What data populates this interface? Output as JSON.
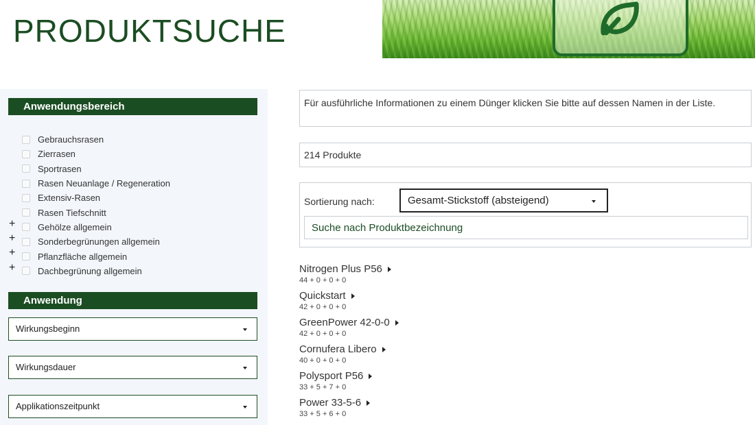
{
  "page": {
    "title": "PRODUKTSUCHE"
  },
  "sidebar": {
    "anwendungsbereich_title": "Anwendungsbereich",
    "anwendungsbereich_items": [
      {
        "label": "Gebrauchsrasen",
        "expandable": false
      },
      {
        "label": "Zierrasen",
        "expandable": false
      },
      {
        "label": "Sportrasen",
        "expandable": false
      },
      {
        "label": "Rasen Neuanlage / Regeneration",
        "expandable": false
      },
      {
        "label": "Extensiv-Rasen",
        "expandable": false
      },
      {
        "label": "Rasen Tiefschnitt",
        "expandable": false
      },
      {
        "label": "Gehölze allgemein",
        "expandable": true
      },
      {
        "label": "Sonderbegrünungen allgemein",
        "expandable": true
      },
      {
        "label": "Pflanzfläche allgemein",
        "expandable": true
      },
      {
        "label": "Dachbegrünung allgemein",
        "expandable": true
      }
    ],
    "expand_symbol": "+",
    "anwendung_title": "Anwendung",
    "selects": {
      "wirkungsbeginn": "Wirkungsbeginn",
      "wirkungsdauer": "Wirkungsdauer",
      "applikationszeitpunkt": "Applikationszeitpunkt"
    }
  },
  "main": {
    "info_text": "Für ausführliche Informationen zu einem Dünger klicken Sie bitte auf dessen Namen in der Liste.",
    "count_text": "214 Produkte",
    "sort_label": "Sortierung nach:",
    "sort_value": "Gesamt-Stickstoff (absteigend)",
    "search_placeholder": "Suche nach Produktbezeichnung",
    "products": [
      {
        "name": "Nitrogen Plus P56",
        "npk": "44 + 0 + 0 + 0"
      },
      {
        "name": "Quickstart",
        "npk": "42 + 0 + 0 + 0"
      },
      {
        "name": "GreenPower 42-0-0",
        "npk": "42 + 0 + 0 + 0"
      },
      {
        "name": "Cornufera Libero",
        "npk": "40 + 0 + 0 + 0"
      },
      {
        "name": "Polysport P56",
        "npk": "33 + 5 + 7 + 0"
      },
      {
        "name": "Power 33-5-6",
        "npk": "33 + 5 + 6 + 0"
      }
    ]
  },
  "colors": {
    "brand_green": "#1b4d22",
    "border_gray": "#c9ced3",
    "sidebar_bg": "#f3f6fb"
  },
  "icons": {
    "banner": "leaf-icon",
    "dropdown": "caret-down-icon",
    "product_link": "caret-right-icon"
  }
}
